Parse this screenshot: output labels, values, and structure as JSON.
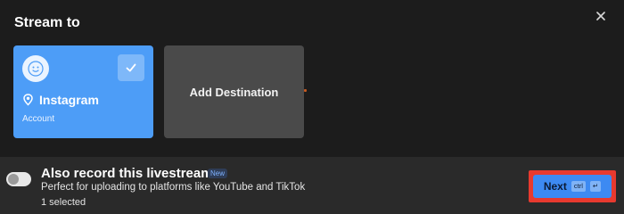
{
  "dialog": {
    "title": "Stream to",
    "close_icon": "close-icon"
  },
  "destinations": [
    {
      "name": "Instagram",
      "subtitle": "Account",
      "selected": true,
      "color": "#4d9df7"
    }
  ],
  "add_destination": {
    "label": "Add Destination",
    "color": "#4a4a4a"
  },
  "record": {
    "title": "Also record this livestream",
    "badge": "New",
    "description": "Perfect for uploading to platforms like YouTube and TikTok",
    "selected_count": "1 selected",
    "toggle_on": false
  },
  "next_button": {
    "label": "Next",
    "shortcut_key": "ctrl",
    "shortcut_enter": "↵",
    "color": "#3d8af2",
    "highlight_color": "#e83a2f"
  }
}
